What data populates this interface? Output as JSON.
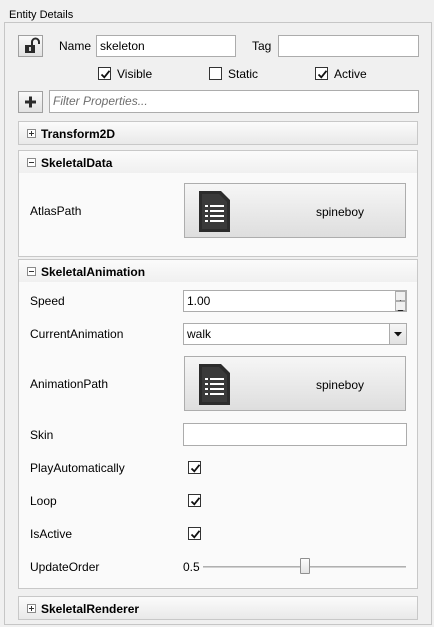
{
  "panel": {
    "title": "Entity Details"
  },
  "entity": {
    "lock_icon": "unlocked-padlock-icon",
    "name_label": "Name",
    "name_value": "skeleton",
    "tag_label": "Tag",
    "tag_value": "",
    "visible_label": "Visible",
    "visible_checked": true,
    "static_label": "Static",
    "static_checked": false,
    "active_label": "Active",
    "active_checked": true
  },
  "filter": {
    "add_icon": "plus-icon",
    "placeholder": "Filter Properties..."
  },
  "components": {
    "transform2d": {
      "title": "Transform2D",
      "expanded": false
    },
    "skeletal_data": {
      "title": "SkeletalData",
      "expanded": true,
      "atlas_path_label": "AtlasPath",
      "atlas_path_value": "spineboy",
      "atlas_icon": "document-icon"
    },
    "skeletal_animation": {
      "title": "SkeletalAnimation",
      "expanded": true,
      "speed_label": "Speed",
      "speed_value": "1.00",
      "current_animation_label": "CurrentAnimation",
      "current_animation_value": "walk",
      "animation_path_label": "AnimationPath",
      "animation_path_value": "spineboy",
      "animation_icon": "document-icon",
      "skin_label": "Skin",
      "skin_value": "",
      "play_automatically_label": "PlayAutomatically",
      "play_automatically": true,
      "loop_label": "Loop",
      "loop": true,
      "is_active_label": "IsActive",
      "is_active": true,
      "update_order_label": "UpdateOrder",
      "update_order_value": "0.5",
      "update_order_fraction": 0.5
    },
    "skeletal_renderer": {
      "title": "SkeletalRenderer",
      "expanded": false
    }
  }
}
